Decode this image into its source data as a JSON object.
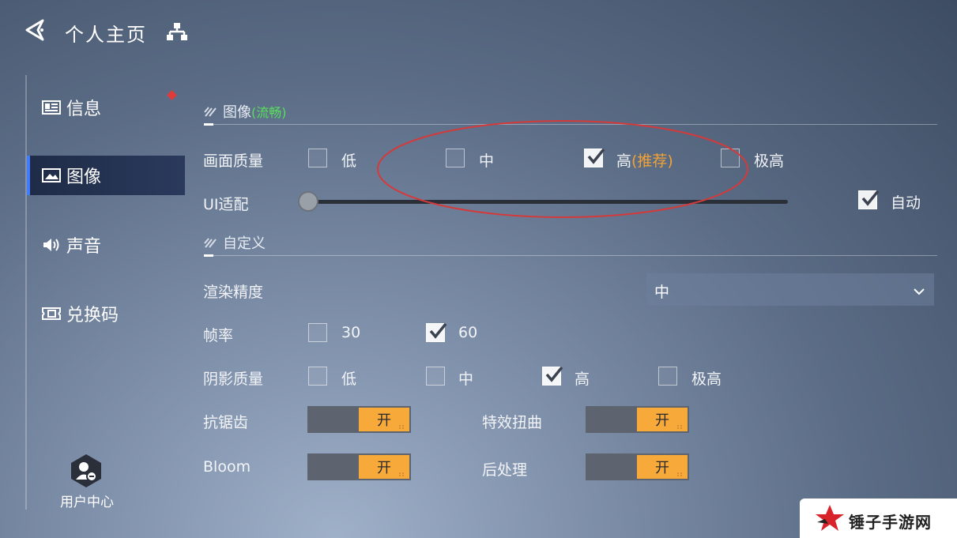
{
  "header": {
    "title": "个人主页"
  },
  "sidebar": {
    "items": [
      {
        "label": "信息",
        "icon": "info-card-icon"
      },
      {
        "label": "图像",
        "icon": "image-icon"
      },
      {
        "label": "声音",
        "icon": "speaker-icon"
      },
      {
        "label": "兑换码",
        "icon": "ticket-icon"
      }
    ],
    "active": "图像",
    "user_center": "用户中心"
  },
  "image_section": {
    "title": "图像",
    "subtitle": "(流畅)"
  },
  "quality": {
    "label": "画面质量",
    "options": [
      {
        "text": "低",
        "checked": false
      },
      {
        "text": "中",
        "checked": false
      },
      {
        "text": "高",
        "extra": "(推荐)",
        "checked": true
      },
      {
        "text": "极高",
        "checked": false
      }
    ]
  },
  "ui_fit": {
    "label": "UI适配",
    "value": 0,
    "auto_label": "自动",
    "auto_checked": true
  },
  "custom_section": {
    "title": "自定义"
  },
  "render_precision": {
    "label": "渲染精度",
    "value": "中"
  },
  "framerate": {
    "label": "帧率",
    "options": [
      {
        "text": "30",
        "checked": false
      },
      {
        "text": "60",
        "checked": true
      }
    ]
  },
  "shadow": {
    "label": "阴影质量",
    "options": [
      {
        "text": "低",
        "checked": false
      },
      {
        "text": "中",
        "checked": false
      },
      {
        "text": "高",
        "checked": true
      },
      {
        "text": "极高",
        "checked": false
      }
    ]
  },
  "toggles": {
    "antialias": {
      "label": "抗锯齿",
      "state": "开"
    },
    "distortion": {
      "label": "特效扭曲",
      "state": "开"
    },
    "bloom": {
      "label": "Bloom",
      "state": "开"
    },
    "postprocess": {
      "label": "后处理",
      "state": "开"
    }
  },
  "watermark": {
    "text": "锤子手游网"
  },
  "colors": {
    "accent": "#f2a236",
    "toggle_on": "#f7a93a",
    "green": "#58e05a",
    "active_border": "#3f7cff",
    "annotation": "#d43a3a"
  }
}
